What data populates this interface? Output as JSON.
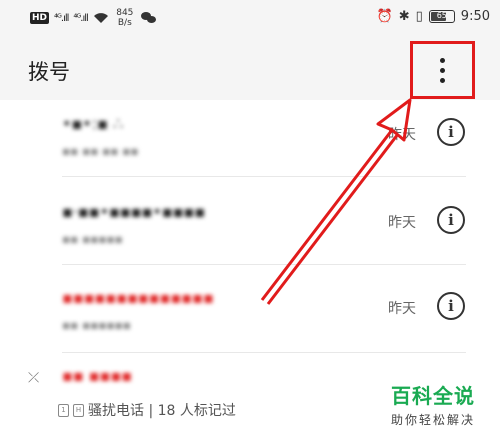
{
  "status_bar": {
    "hd": "HD",
    "signal_1": "⁴ᴳ.ıll",
    "signal_2": "⁴ᴳ.ıll",
    "speed_value": "845",
    "speed_unit": "B/s",
    "battery": "65",
    "time": "9:50"
  },
  "app_bar": {
    "title": "拨号",
    "more_icon": "more-vertical-icon",
    "highlight_color": "#e11b1b"
  },
  "calls": [
    {
      "name": "•▪•:▪ ∴",
      "sub": "▪▪ ▪▪ ▪▪ ▪▪",
      "time": "昨天",
      "missed": false
    },
    {
      "name": "▪·▪▪•▪▪▪▪•▪▪▪▪",
      "sub": "▪▪ ▪▪▪▪▪",
      "time": "昨天",
      "missed": false
    },
    {
      "name": "▪▪▪▪▪▪▪▪▪▪▪▪▪▪",
      "sub": "▪▪ ▪▪▪▪▪▪",
      "time": "昨天",
      "missed": true
    }
  ],
  "blocked_call": {
    "name": "▪▪ ▪▪▪▪",
    "sub": "骚扰电话 | 18 人标记过"
  },
  "watermark": {
    "title": "百科全说",
    "subtitle": "助你轻松解决"
  },
  "colors": {
    "missed": "#e02828",
    "watermark": "#1aaa52",
    "arrow": "#e11b1b"
  }
}
